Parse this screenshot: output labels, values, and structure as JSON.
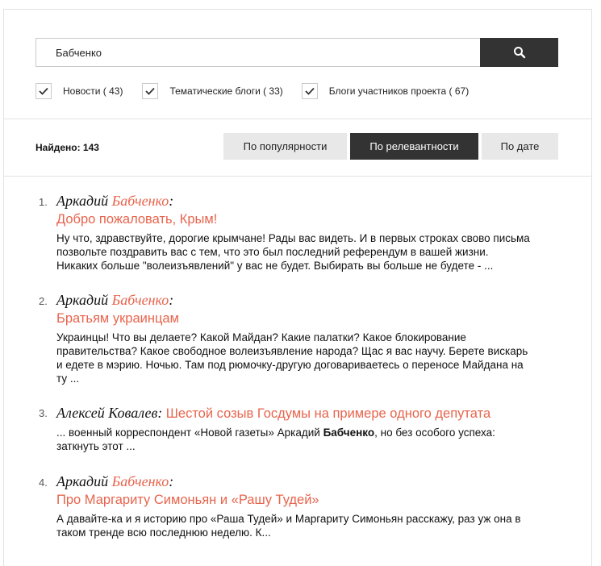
{
  "search": {
    "value": "Бабченко",
    "button_icon": "search-icon"
  },
  "filters": [
    {
      "label": "Новости ( 43)",
      "checked": true
    },
    {
      "label": "Тематические блоги ( 33)",
      "checked": true
    },
    {
      "label": "Блоги участников проекта ( 67)",
      "checked": true
    }
  ],
  "found": "Найдено: 143",
  "sort": {
    "popularity": "По популярности",
    "relevance": "По релевантности",
    "date": "По дате",
    "active": "relevance"
  },
  "colors": {
    "accent": "#e8644c",
    "dark": "#333333"
  },
  "results": [
    {
      "num": "1.",
      "author_first": "Аркадий ",
      "author_last": "Бабченко",
      "author_suffix": ":",
      "title": "Добро пожаловать, Крым!",
      "snippet_lines": [
        "Ну что, здравствуйте, дорогие крымчане! Рады вас видеть. И в первых строках свово письма",
        "позвольте поздравить вас с тем, что это был последний референдум в вашей жизни.",
        "Никаких больше \"волеизъявлений\" у вас не будет. Выбирать вы больше не будете - ..."
      ]
    },
    {
      "num": "2.",
      "author_first": "Аркадий ",
      "author_last": "Бабченко",
      "author_suffix": ":",
      "title": "Братьям украинцам",
      "snippet_lines": [
        "Украинцы! Что вы делаете? Какой Майдан? Какие палатки? Какое блокирование",
        "правительства? Какое свободное волеизъявление народа? Щас я вас научу. Берете вискарь",
        "и едете в мэрию. Ночью. Там под рюмочку-другую договариваетесь о переносе Майдана на",
        "ту ..."
      ]
    },
    {
      "num": "3.",
      "author_full": "Алексей Ковалев:",
      "title": "Шестой созыв Госдумы на примере одного депутата",
      "snippet_pre": "... военный корреспондент «Новой газеты» Аркадий ",
      "snippet_bold": "Бабченко",
      "snippet_post": ", но без особого успеха:",
      "snippet_line2": "заткнуть этот ..."
    },
    {
      "num": "4.",
      "author_first": "Аркадий ",
      "author_last": "Бабченко",
      "author_suffix": ":",
      "title": "Про Маргариту Симоньян и «Рашу Тудей»",
      "snippet_lines": [
        "А давайте-ка и я историю про «Раша Тудей» и Маргариту Симоньян расскажу, раз уж она в",
        "таком тренде всю последнюю неделю. К..."
      ]
    }
  ]
}
